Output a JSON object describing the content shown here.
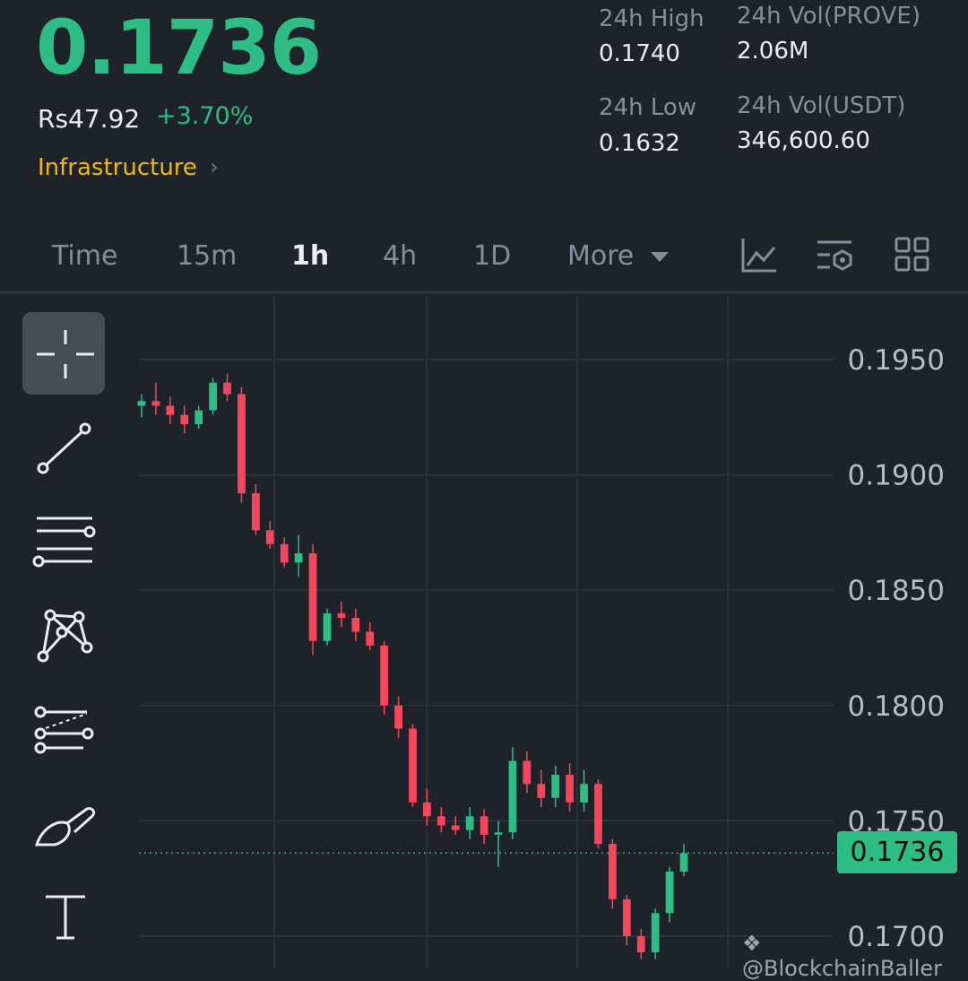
{
  "ticker": {
    "last_price": "0.1736",
    "fiat_price": "Rs47.92",
    "change_pct": "+3.70%",
    "category": "Infrastructure",
    "up_color": "#2ebd85",
    "down_color": "#f6465d",
    "accent_color": "#f0b90b"
  },
  "stats": {
    "high_label": "24h High",
    "high_value": "0.1740",
    "low_label": "24h Low",
    "low_value": "0.1632",
    "vol_base_label": "24h Vol(PROVE)",
    "vol_base_value": "2.06M",
    "vol_quote_label": "24h Vol(USDT)",
    "vol_quote_value": "346,600.60"
  },
  "intervals": {
    "time": "Time",
    "m15": "15m",
    "h1": "1h",
    "h4": "4h",
    "d1": "1D",
    "more": "More",
    "selected": "1h"
  },
  "toolbar_icons": [
    "line-chart-icon",
    "indicator-settings-icon",
    "grid-layout-icon"
  ],
  "drawing_tools": [
    "crosshair-icon",
    "trend-line-icon",
    "horizontal-lines-icon",
    "pattern-icon",
    "fib-channel-icon",
    "brush-icon",
    "text-tool-icon"
  ],
  "chart_data": {
    "type": "candlestick",
    "ylim": [
      0.169,
      0.197
    ],
    "y_ticks": [
      "0.1950",
      "0.1900",
      "0.1850",
      "0.1800",
      "0.1750",
      "0.1700"
    ],
    "y_tick_values": [
      0.195,
      0.19,
      0.185,
      0.18,
      0.175,
      0.17
    ],
    "current_price": 0.1736,
    "current_price_label": "0.1736",
    "candles": [
      [
        0.193,
        0.1935,
        0.1925,
        0.1932
      ],
      [
        0.1932,
        0.194,
        0.1926,
        0.193
      ],
      [
        0.193,
        0.1934,
        0.1922,
        0.1926
      ],
      [
        0.1926,
        0.193,
        0.1918,
        0.1922
      ],
      [
        0.1922,
        0.193,
        0.192,
        0.1928
      ],
      [
        0.1928,
        0.1942,
        0.1926,
        0.194
      ],
      [
        0.194,
        0.1944,
        0.1932,
        0.1935
      ],
      [
        0.1935,
        0.1938,
        0.1888,
        0.1892
      ],
      [
        0.1892,
        0.1896,
        0.1874,
        0.1876
      ],
      [
        0.1876,
        0.188,
        0.1868,
        0.187
      ],
      [
        0.187,
        0.1873,
        0.186,
        0.1862
      ],
      [
        0.1862,
        0.1874,
        0.1856,
        0.1866
      ],
      [
        0.1866,
        0.187,
        0.1822,
        0.1828
      ],
      [
        0.1828,
        0.1842,
        0.1826,
        0.184
      ],
      [
        0.184,
        0.1845,
        0.1834,
        0.1838
      ],
      [
        0.1838,
        0.1842,
        0.1828,
        0.1832
      ],
      [
        0.1832,
        0.1836,
        0.1824,
        0.1826
      ],
      [
        0.1826,
        0.1828,
        0.1796,
        0.18
      ],
      [
        0.18,
        0.1804,
        0.1786,
        0.179
      ],
      [
        0.179,
        0.1792,
        0.1756,
        0.1758
      ],
      [
        0.1758,
        0.1764,
        0.1748,
        0.1752
      ],
      [
        0.1752,
        0.1756,
        0.1745,
        0.1748
      ],
      [
        0.1748,
        0.1752,
        0.1744,
        0.1746
      ],
      [
        0.1746,
        0.1756,
        0.1742,
        0.1752
      ],
      [
        0.1752,
        0.1755,
        0.174,
        0.1744
      ],
      [
        0.1744,
        0.175,
        0.173,
        0.1745
      ],
      [
        0.1745,
        0.1782,
        0.1742,
        0.1776
      ],
      [
        0.1776,
        0.178,
        0.1762,
        0.1766
      ],
      [
        0.1766,
        0.1772,
        0.1756,
        0.176
      ],
      [
        0.176,
        0.1774,
        0.1756,
        0.177
      ],
      [
        0.177,
        0.1775,
        0.1754,
        0.1758
      ],
      [
        0.1758,
        0.1772,
        0.1754,
        0.1766
      ],
      [
        0.1766,
        0.1768,
        0.1738,
        0.174
      ],
      [
        0.174,
        0.1742,
        0.1712,
        0.1716
      ],
      [
        0.1716,
        0.1718,
        0.1696,
        0.17
      ],
      [
        0.17,
        0.1703,
        0.169,
        0.1693
      ],
      [
        0.1693,
        0.1712,
        0.169,
        0.171
      ],
      [
        0.171,
        0.173,
        0.1706,
        0.1728
      ],
      [
        0.1728,
        0.174,
        0.1726,
        0.1736
      ]
    ],
    "grid": true
  },
  "watermark": "@BlockchainBaller"
}
